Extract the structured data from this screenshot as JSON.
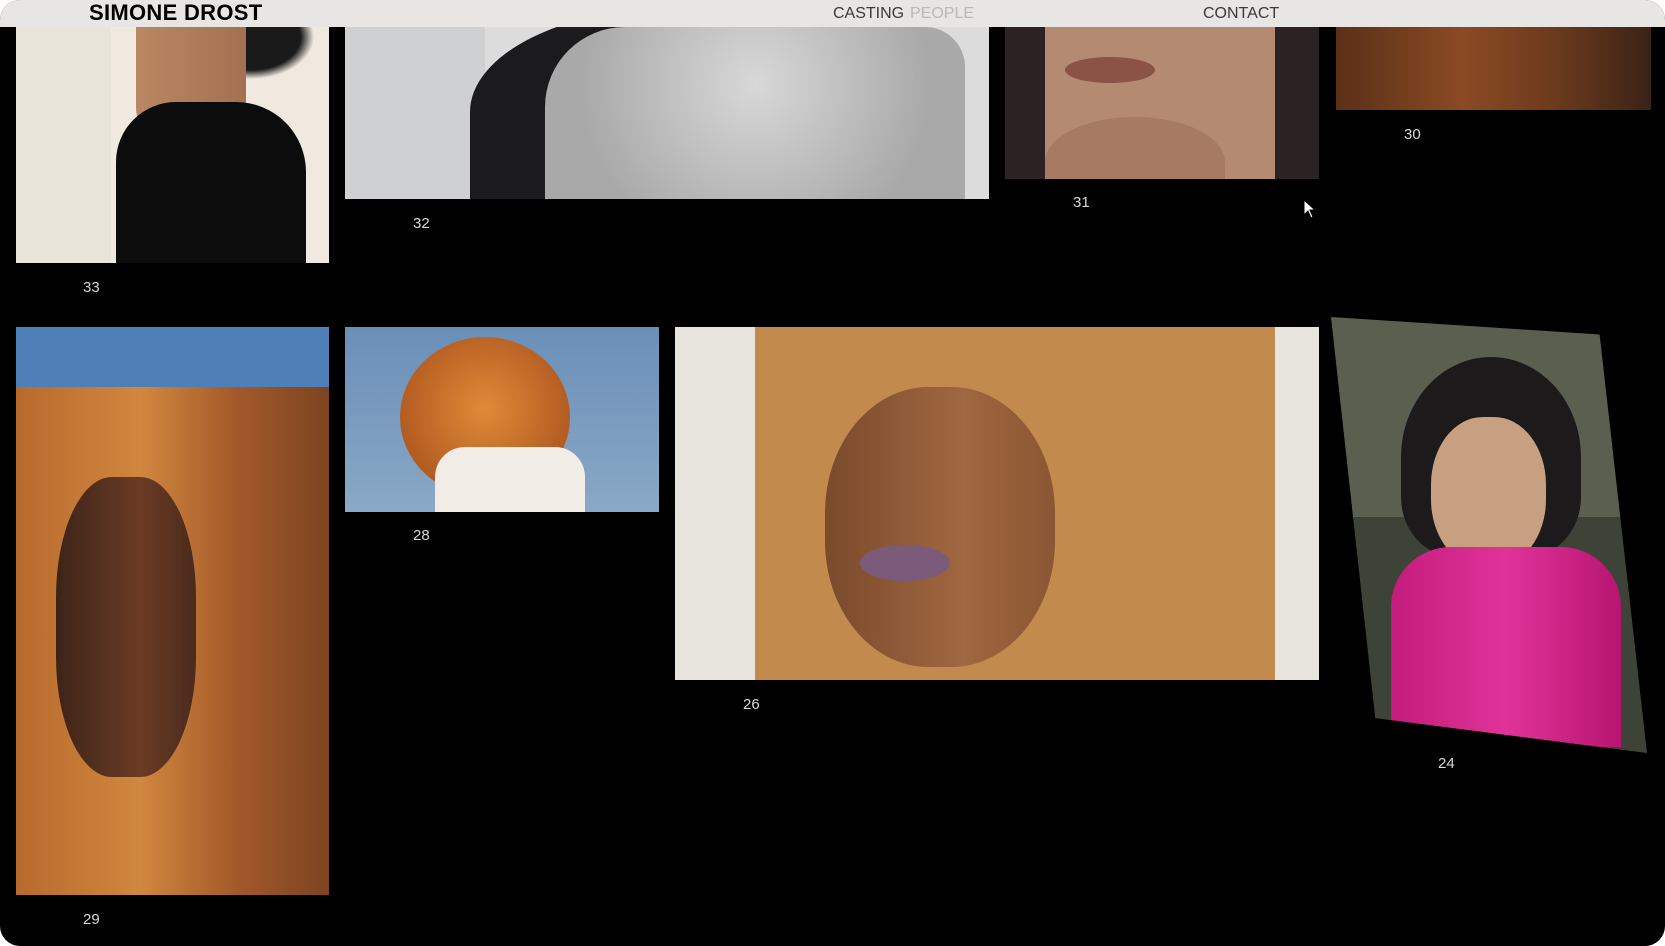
{
  "header": {
    "brand": "SIMONE DROST",
    "nav": [
      {
        "label": "CASTING",
        "active": false
      },
      {
        "label": "PEOPLE",
        "active": true
      },
      {
        "label": "CONTACT",
        "active": false
      }
    ]
  },
  "gallery": {
    "items": [
      {
        "number": "33"
      },
      {
        "number": "32"
      },
      {
        "number": "31"
      },
      {
        "number": "30"
      },
      {
        "number": "29"
      },
      {
        "number": "28"
      },
      {
        "number": "26"
      },
      {
        "number": "24"
      }
    ]
  },
  "colors": {
    "page_background": "#000000",
    "header_background": "#e7e6e4",
    "nav_text": "#3a3a3a",
    "nav_active_text": "#b9b9b9",
    "caption_text": "#d8d8d8"
  },
  "icons": {
    "cursor": "mouse-pointer-icon"
  }
}
